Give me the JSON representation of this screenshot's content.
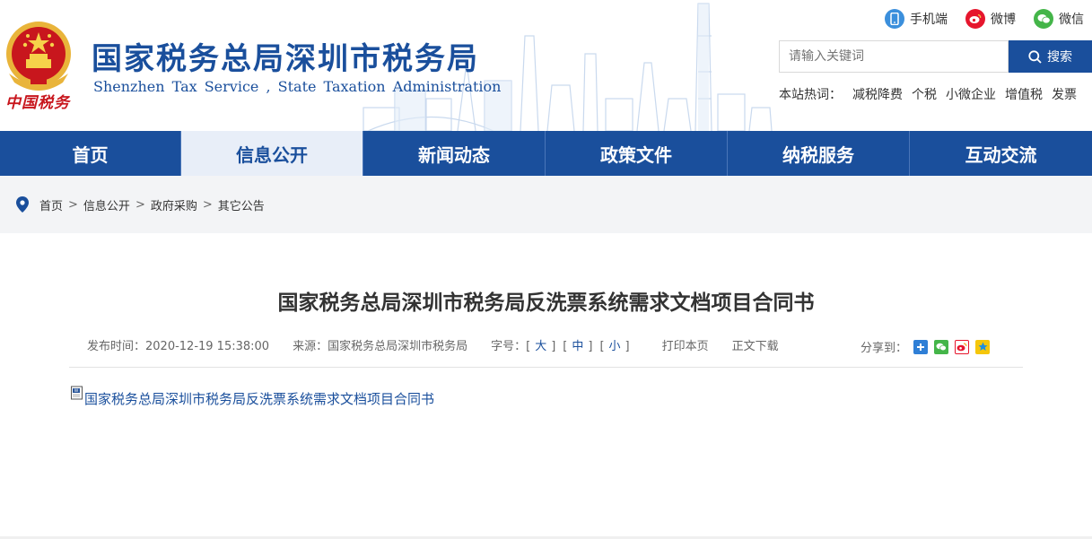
{
  "header": {
    "title": "国家税务总局深圳市税务局",
    "subtitle": "Shenzhen Tax Service , State Taxation Administration",
    "emblem_text": "中国税务",
    "quick_links": [
      {
        "label": "手机端",
        "icon": "mobile-icon",
        "color": "#3b8fdc"
      },
      {
        "label": "微博",
        "icon": "weibo-icon",
        "color": "#e6162d"
      },
      {
        "label": "微信",
        "icon": "wechat-icon",
        "color": "#44b549"
      }
    ],
    "search": {
      "placeholder": "请输入关键词",
      "button_label": "搜索"
    },
    "hot_words": {
      "label": "本站热词：",
      "items": [
        "减税降费",
        "个税",
        "小微企业",
        "增值税",
        "发票"
      ]
    }
  },
  "nav": {
    "items": [
      {
        "label": "首页",
        "active": false
      },
      {
        "label": "信息公开",
        "active": true
      },
      {
        "label": "新闻动态",
        "active": false
      },
      {
        "label": "政策文件",
        "active": false
      },
      {
        "label": "纳税服务",
        "active": false
      },
      {
        "label": "互动交流",
        "active": false
      }
    ]
  },
  "breadcrumb": {
    "items": [
      "首页",
      "信息公开",
      "政府采购",
      "其它公告"
    ],
    "separator": ">"
  },
  "article": {
    "title": "国家税务总局深圳市税务局反洗票系统需求文档项目合同书",
    "publish_time": "发布时间：2020-12-19 15:38:00",
    "source": "来源：国家税务总局深圳市税务局",
    "font_size_label": "字号：",
    "font_sizes": [
      "大",
      "中",
      "小"
    ],
    "print_label": "打印本页",
    "download_label": "正文下载",
    "share_label": "分享到：",
    "share_icons": [
      "share-more-icon",
      "wechat-share-icon",
      "weibo-share-icon",
      "qzone-share-icon"
    ],
    "attachment": "国家税务总局深圳市税务局反洗票系统需求文档项目合同书"
  },
  "colors": {
    "brand_blue": "#1a4f9c",
    "nav_active_bg": "#e8eef8",
    "emblem_red": "#c8161d"
  }
}
